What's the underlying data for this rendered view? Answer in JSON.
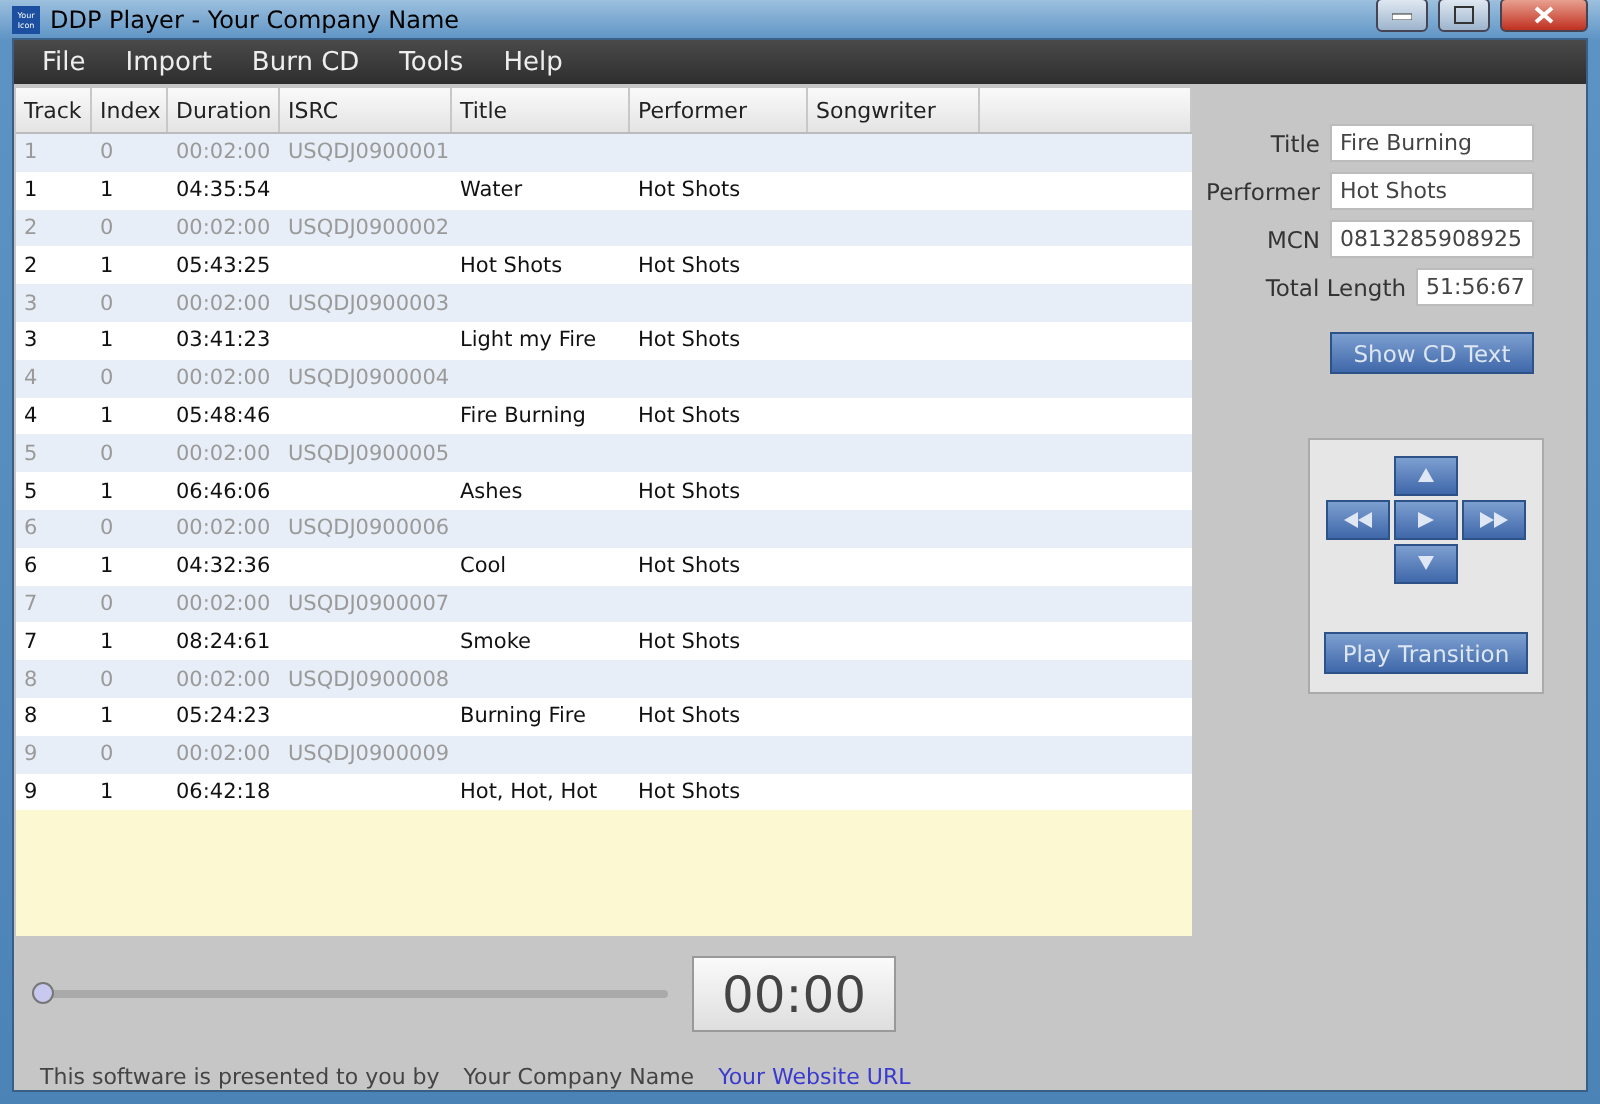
{
  "window": {
    "title": "DDP Player - Your Company Name",
    "app_icon": "Your Icon"
  },
  "menu": [
    "File",
    "Import",
    "Burn CD",
    "Tools",
    "Help"
  ],
  "table": {
    "columns": [
      "Track",
      "Index",
      "Duration",
      "ISRC",
      "Title",
      "Performer",
      "Songwriter"
    ],
    "rows": [
      {
        "kind": "pregap",
        "cells": [
          "1",
          "0",
          "00:02:00",
          "USQDJ0900001",
          "",
          ""
        ]
      },
      {
        "kind": "track",
        "cells": [
          "1",
          "1",
          "04:35:54",
          "",
          "Water",
          "Hot Shots"
        ]
      },
      {
        "kind": "pregap",
        "cells": [
          "2",
          "0",
          "00:02:00",
          "USQDJ0900002",
          "",
          ""
        ]
      },
      {
        "kind": "track",
        "cells": [
          "2",
          "1",
          "05:43:25",
          "",
          "Hot Shots",
          "Hot Shots"
        ]
      },
      {
        "kind": "pregap",
        "cells": [
          "3",
          "0",
          "00:02:00",
          "USQDJ0900003",
          "",
          ""
        ]
      },
      {
        "kind": "track",
        "cells": [
          "3",
          "1",
          "03:41:23",
          "",
          "Light my Fire",
          "Hot Shots"
        ]
      },
      {
        "kind": "pregap",
        "cells": [
          "4",
          "0",
          "00:02:00",
          "USQDJ0900004",
          "",
          ""
        ]
      },
      {
        "kind": "track",
        "cells": [
          "4",
          "1",
          "05:48:46",
          "",
          "Fire Burning",
          "Hot Shots"
        ]
      },
      {
        "kind": "pregap",
        "cells": [
          "5",
          "0",
          "00:02:00",
          "USQDJ0900005",
          "",
          ""
        ]
      },
      {
        "kind": "track",
        "cells": [
          "5",
          "1",
          "06:46:06",
          "",
          "Ashes",
          "Hot Shots"
        ]
      },
      {
        "kind": "pregap",
        "cells": [
          "6",
          "0",
          "00:02:00",
          "USQDJ0900006",
          "",
          ""
        ]
      },
      {
        "kind": "track",
        "cells": [
          "6",
          "1",
          "04:32:36",
          "",
          "Cool",
          "Hot Shots"
        ]
      },
      {
        "kind": "pregap",
        "cells": [
          "7",
          "0",
          "00:02:00",
          "USQDJ0900007",
          "",
          ""
        ]
      },
      {
        "kind": "track",
        "cells": [
          "7",
          "1",
          "08:24:61",
          "",
          "Smoke",
          "Hot Shots"
        ]
      },
      {
        "kind": "pregap",
        "cells": [
          "8",
          "0",
          "00:02:00",
          "USQDJ0900008",
          "",
          ""
        ]
      },
      {
        "kind": "track",
        "cells": [
          "8",
          "1",
          "05:24:23",
          "",
          "Burning Fire",
          "Hot Shots"
        ]
      },
      {
        "kind": "pregap",
        "cells": [
          "9",
          "0",
          "00:02:00",
          "USQDJ0900009",
          "",
          ""
        ]
      },
      {
        "kind": "track",
        "cells": [
          "9",
          "1",
          "06:42:18",
          "",
          "Hot, Hot, Hot",
          "Hot Shots"
        ]
      }
    ]
  },
  "info": {
    "fields": [
      {
        "label": "Title",
        "value": "Fire Burning"
      },
      {
        "label": "Performer",
        "value": "Hot Shots"
      },
      {
        "label": "MCN",
        "value": "0813285908925"
      },
      {
        "label": "Total Length",
        "value": "51:56:67"
      }
    ],
    "show_cd_text_button": "Show CD Text"
  },
  "transport": {
    "play_transition_button": "Play Transition"
  },
  "position": {
    "level": 0
  },
  "time_display": "00:00",
  "footer": {
    "text": "This software is presented to you by",
    "company": "Your Company Name",
    "link": "Your Website URL"
  }
}
